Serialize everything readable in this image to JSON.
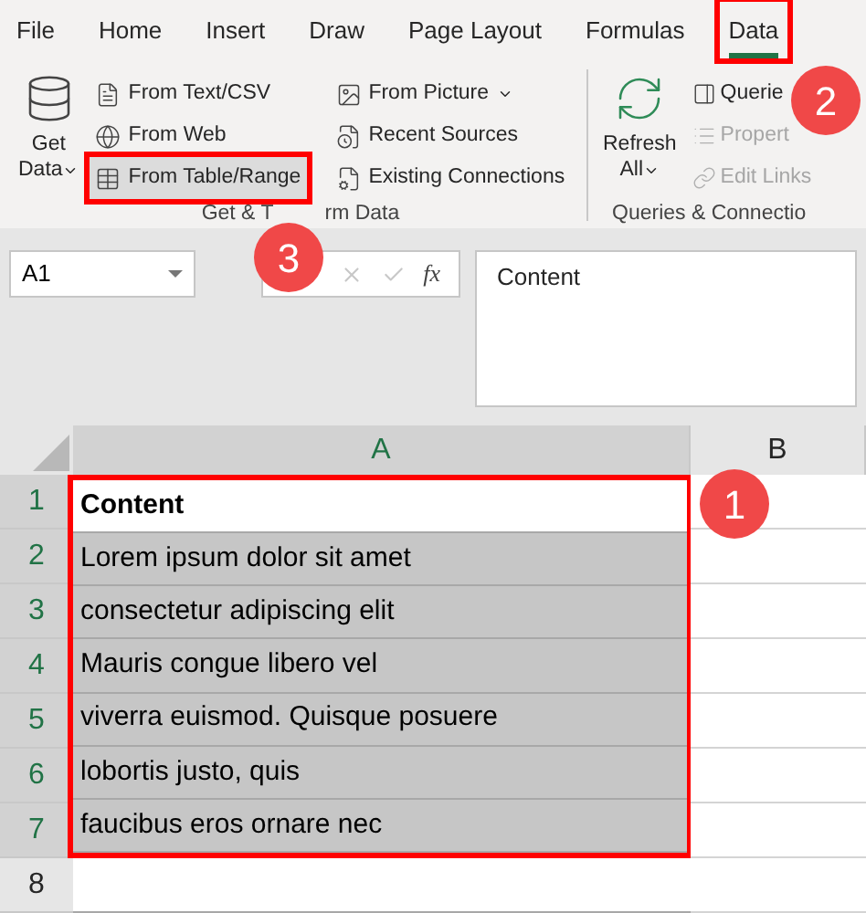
{
  "tabs": [
    {
      "label": "File",
      "selected": false,
      "highlighted": false
    },
    {
      "label": "Home",
      "selected": false,
      "highlighted": false
    },
    {
      "label": "Insert",
      "selected": false,
      "highlighted": false
    },
    {
      "label": "Draw",
      "selected": false,
      "highlighted": false
    },
    {
      "label": "Page Layout",
      "selected": false,
      "highlighted": false
    },
    {
      "label": "Formulas",
      "selected": false,
      "highlighted": false
    },
    {
      "label": "Data",
      "selected": true,
      "highlighted": true
    }
  ],
  "ribbon": {
    "groups": [
      {
        "label_parts": [
          "Get & T",
          "rm Data"
        ],
        "large": {
          "label_lines": [
            "Get",
            "Data"
          ],
          "caret": true
        },
        "columns": [
          [
            {
              "label": "From Text/CSV",
              "hovered": false,
              "disabled": false,
              "highlighted": false
            },
            {
              "label": "From Web",
              "hovered": false,
              "disabled": false,
              "highlighted": false
            },
            {
              "label": "From Table/Range",
              "hovered": true,
              "disabled": false,
              "highlighted": true
            }
          ],
          [
            {
              "label": "From Picture",
              "hovered": false,
              "disabled": false,
              "highlighted": false,
              "caret": true
            },
            {
              "label": "Recent Sources",
              "hovered": false,
              "disabled": false,
              "highlighted": false
            },
            {
              "label": "Existing Connections",
              "hovered": false,
              "disabled": false,
              "highlighted": false
            }
          ]
        ]
      },
      {
        "label_parts": [
          "Queries & Connectio"
        ],
        "large": {
          "label_lines": [
            "Refresh",
            "All"
          ],
          "caret": true
        },
        "columns": [
          [
            {
              "label": "Querie",
              "hovered": false,
              "disabled": false,
              "highlighted": false
            },
            {
              "label": "Propert",
              "hovered": false,
              "disabled": true,
              "highlighted": false
            },
            {
              "label": "Edit Links",
              "hovered": false,
              "disabled": true,
              "highlighted": false
            }
          ]
        ]
      }
    ]
  },
  "formula_bar": {
    "name_box": "A1",
    "fx": "fx",
    "formula": "Content"
  },
  "grid": {
    "range_highlighted": true,
    "columns": [
      {
        "label": "A",
        "selected": true
      },
      {
        "label": "B",
        "selected": false
      }
    ],
    "rows": [
      {
        "number": "1",
        "cells": [
          "Content",
          ""
        ],
        "selected": true,
        "active": true
      },
      {
        "number": "2",
        "cells": [
          "Lorem ipsum dolor sit amet",
          ""
        ],
        "selected": true
      },
      {
        "number": "3",
        "cells": [
          "consectetur adipiscing elit",
          ""
        ],
        "selected": true
      },
      {
        "number": "4",
        "cells": [
          "Mauris congue libero vel",
          ""
        ],
        "selected": true
      },
      {
        "number": "5",
        "cells": [
          "viverra euismod. Quisque posuere",
          ""
        ],
        "selected": true
      },
      {
        "number": "6",
        "cells": [
          "lobortis justo, quis",
          ""
        ],
        "selected": true
      },
      {
        "number": "7",
        "cells": [
          "faucibus eros ornare nec",
          ""
        ],
        "selected": true
      },
      {
        "number": "8",
        "cells": [
          "",
          ""
        ],
        "selected": false
      }
    ]
  },
  "callouts": [
    "1",
    "2",
    "3"
  ]
}
